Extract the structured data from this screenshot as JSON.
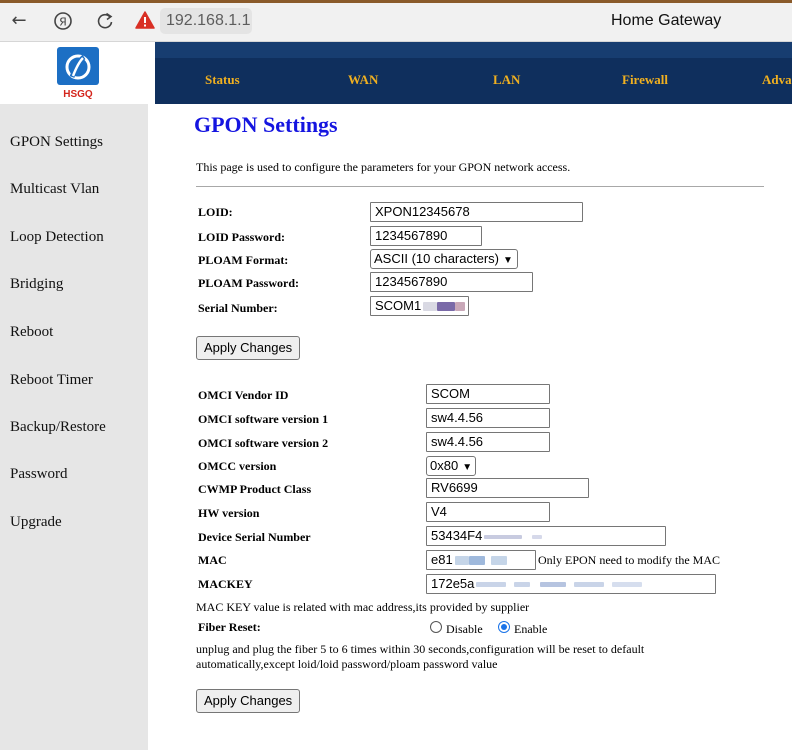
{
  "browser": {
    "back_icon": "arrow-left-icon",
    "yandex_icon": "yandex-icon",
    "reload_icon": "reload-icon",
    "warning_icon": "warning-icon",
    "url": "192.168.1.1",
    "tab_title": "Home Gateway"
  },
  "header": {
    "logo_text": "HSGQ",
    "nav": [
      "Status",
      "WAN",
      "LAN",
      "Firewall",
      "Adva"
    ]
  },
  "sidebar": {
    "items": [
      "GPON Settings",
      "Multicast Vlan",
      "Loop Detection",
      "Bridging",
      "Reboot",
      "Reboot Timer",
      "Backup/Restore",
      "Password",
      "Upgrade"
    ]
  },
  "gpon": {
    "title": "GPON Settings",
    "description": "This page is used to configure the parameters for your GPON network access.",
    "loid_label": "LOID:",
    "loid_value": "XPON12345678",
    "loid_password_label": "LOID Password:",
    "loid_password_value": "1234567890",
    "ploam_format_label": "PLOAM Format:",
    "ploam_format_value": "ASCII (10 characters)",
    "ploam_password_label": "PLOAM Password:",
    "ploam_password_value": "1234567890",
    "serial_label": "Serial Number:",
    "serial_value": "SCOM1",
    "apply_label": "Apply Changes"
  },
  "omci": {
    "vendor_id_label": "OMCI Vendor ID",
    "vendor_id_value": "SCOM",
    "sw1_label": "OMCI software version 1",
    "sw1_value": "sw4.4.56",
    "sw2_label": "OMCI software version 2",
    "sw2_value": "sw4.4.56",
    "omcc_label": "OMCC version",
    "omcc_value": "0x80",
    "cwmp_label": "CWMP Product Class",
    "cwmp_value": "RV6699",
    "hw_label": "HW version",
    "hw_value": "V4",
    "dsn_label": "Device Serial Number",
    "dsn_value": "53434F4",
    "mac_label": "MAC",
    "mac_value": "e81",
    "mac_note": "Only EPON need to modify the MAC",
    "mackey_label": "MACKEY",
    "mackey_value": "172e5a",
    "mackey_note": "MAC KEY value is related with mac address,its provided by supplier",
    "fiber_reset_label": "Fiber Reset:",
    "fiber_disable": "Disable",
    "fiber_enable": "Enable",
    "fiber_reset_selected": "Enable",
    "fiber_note_line1": "unplug and plug the fiber 5 to 6 times within 30 seconds,configuration will be reset to default",
    "fiber_note_line2": "automatically,except loid/loid password/ploam password value",
    "apply_label": "Apply Changes"
  },
  "colors": {
    "title_blue": "#1515e0",
    "nav_bg": "#0f2f5d",
    "nav_text": "#f0b020",
    "sidebar_bg": "#e6e6e6",
    "radio_blue": "#1a73e8",
    "warning_red": "#d93025"
  }
}
